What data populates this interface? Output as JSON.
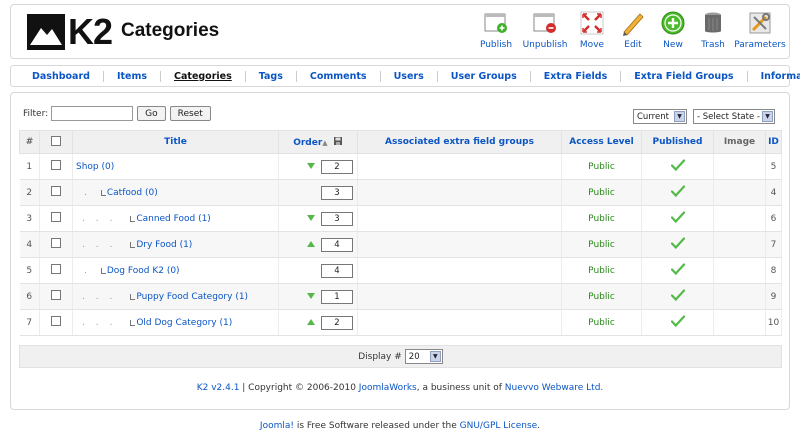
{
  "header": {
    "logo_text": "K2",
    "title": "Categories"
  },
  "toolbar": [
    {
      "label": "Publish",
      "icon": "publish-icon"
    },
    {
      "label": "Unpublish",
      "icon": "unpublish-icon"
    },
    {
      "label": "Move",
      "icon": "move-icon"
    },
    {
      "label": "Edit",
      "icon": "edit-icon"
    },
    {
      "label": "New",
      "icon": "new-icon"
    },
    {
      "label": "Trash",
      "icon": "trash-icon"
    },
    {
      "label": "Parameters",
      "icon": "parameters-icon"
    }
  ],
  "submenu": [
    "Dashboard",
    "Items",
    "Categories",
    "Tags",
    "Comments",
    "Users",
    "User Groups",
    "Extra Fields",
    "Extra Field Groups",
    "Information"
  ],
  "submenu_active": "Categories",
  "filter": {
    "label": "Filter:",
    "value": "",
    "go": "Go",
    "reset": "Reset",
    "current": "Current",
    "state": "- Select State -"
  },
  "columns": {
    "num": "#",
    "title": "Title",
    "order": "Order",
    "extra": "Associated extra field groups",
    "access": "Access Level",
    "published": "Published",
    "image": "Image",
    "id": "ID"
  },
  "rows": [
    {
      "num": "1",
      "dots": "",
      "title": "Shop (0)",
      "order_arrow": "down",
      "order": "2",
      "access": "Public",
      "id": "5"
    },
    {
      "num": "2",
      "dots": ".",
      "title": "Catfood (0)",
      "order_arrow": "",
      "order": "3",
      "access": "Public",
      "id": "4"
    },
    {
      "num": "3",
      "dots": ". . .",
      "title": "Canned Food (1)",
      "order_arrow": "down",
      "order": "3",
      "access": "Public",
      "id": "6"
    },
    {
      "num": "4",
      "dots": ". . .",
      "title": "Dry Food (1)",
      "order_arrow": "up",
      "order": "4",
      "access": "Public",
      "id": "7"
    },
    {
      "num": "5",
      "dots": ".",
      "title": "Dog Food K2 (0)",
      "order_arrow": "",
      "order": "4",
      "access": "Public",
      "id": "8"
    },
    {
      "num": "6",
      "dots": ". . .",
      "title": "Puppy Food Category (1)",
      "order_arrow": "down",
      "order": "1",
      "access": "Public",
      "id": "9"
    },
    {
      "num": "7",
      "dots": ". . .",
      "title": "Old Dog Category (1)",
      "order_arrow": "up",
      "order": "2",
      "access": "Public",
      "id": "10"
    }
  ],
  "pagination": {
    "label": "Display #",
    "value": "20"
  },
  "credits": {
    "version": "K2 v2.4.1",
    "sep": " | Copyright © 2006-2010 ",
    "company": "JoomlaWorks",
    "mid": ", a business unit of ",
    "parent": "Nuevvo Webware Ltd."
  },
  "bottom": {
    "joomla": "Joomla!",
    "mid": " is Free Software released under the ",
    "license": "GNU/GPL License",
    "end": "."
  },
  "colors": {
    "link": "#0b55c4",
    "public": "#2a8a1a",
    "check": "#54b948"
  }
}
